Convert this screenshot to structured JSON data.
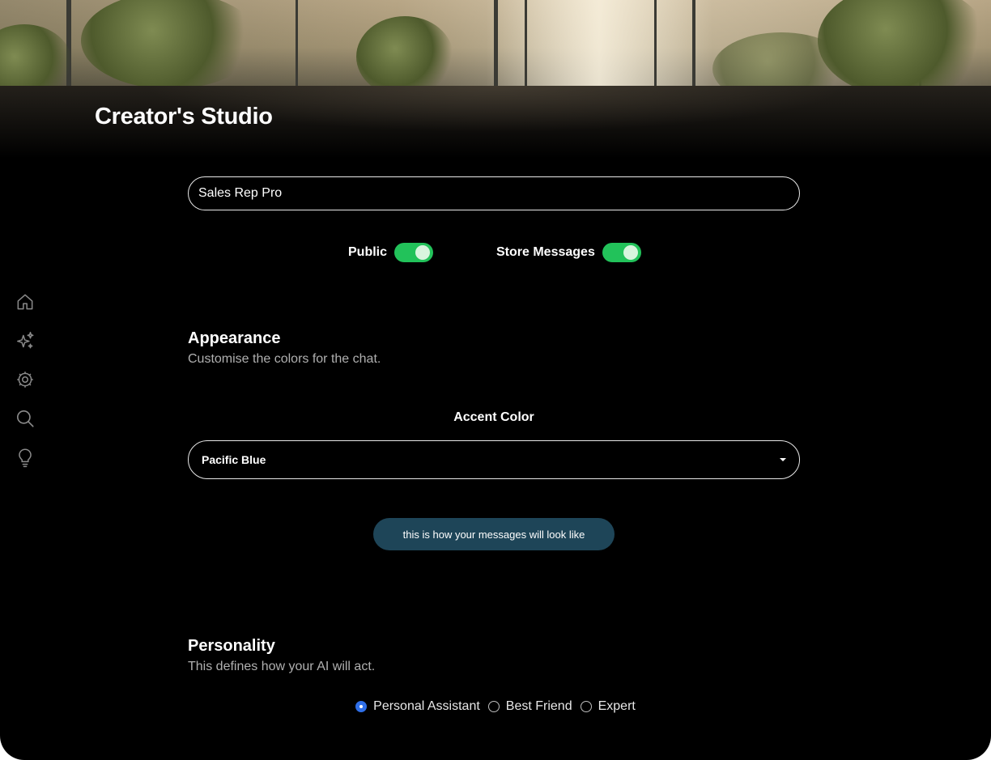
{
  "header": {
    "title": "Creator's Studio"
  },
  "sidebar": {
    "items": [
      {
        "icon": "home-icon"
      },
      {
        "icon": "sparkles-icon"
      },
      {
        "icon": "settings-icon"
      },
      {
        "icon": "search-icon"
      },
      {
        "icon": "lightbulb-icon"
      }
    ]
  },
  "form": {
    "name_value": "Sales Rep Pro",
    "toggles": {
      "public_label": "Public",
      "public_on": true,
      "store_label": "Store Messages",
      "store_on": true
    }
  },
  "appearance": {
    "title": "Appearance",
    "subtitle": "Customise the colors for the chat.",
    "accent_label": "Accent Color",
    "accent_value": "Pacific Blue",
    "preview_text": "this is how your messages will look like"
  },
  "personality": {
    "title": "Personality",
    "subtitle": "This defines how your AI will act.",
    "options": [
      {
        "label": "Personal Assistant",
        "selected": true
      },
      {
        "label": "Best Friend",
        "selected": false
      },
      {
        "label": "Expert",
        "selected": false
      }
    ]
  },
  "colors": {
    "background": "#000000",
    "toggle_on": "#22c25a",
    "preview_bubble": "#1e4558",
    "radio_selected": "#2f6fe8"
  }
}
